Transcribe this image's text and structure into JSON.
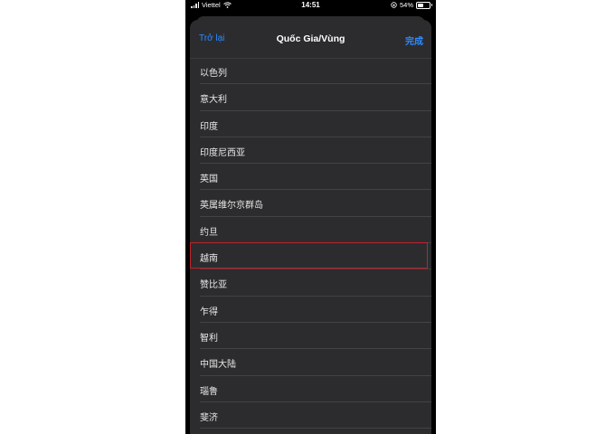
{
  "status_bar": {
    "carrier": "Viettel",
    "time": "14:51",
    "battery_percent": "54%",
    "battery_level": 0.54
  },
  "nav": {
    "back_label": "Trở lại",
    "title": "Quốc Gia/Vùng",
    "done_label": "完成"
  },
  "countries": [
    "以色列",
    "意大利",
    "印度",
    "印度尼西亚",
    "英国",
    "英属维尔京群岛",
    "约旦",
    "越南",
    "赞比亚",
    "乍得",
    "智利",
    "中国大陆",
    "瑙鲁",
    "斐济"
  ],
  "highlighted_country_index": 7,
  "colors": {
    "accent": "#2f8bff",
    "highlight_border": "#c0212b",
    "sheet_bg": "#2c2c2e"
  }
}
